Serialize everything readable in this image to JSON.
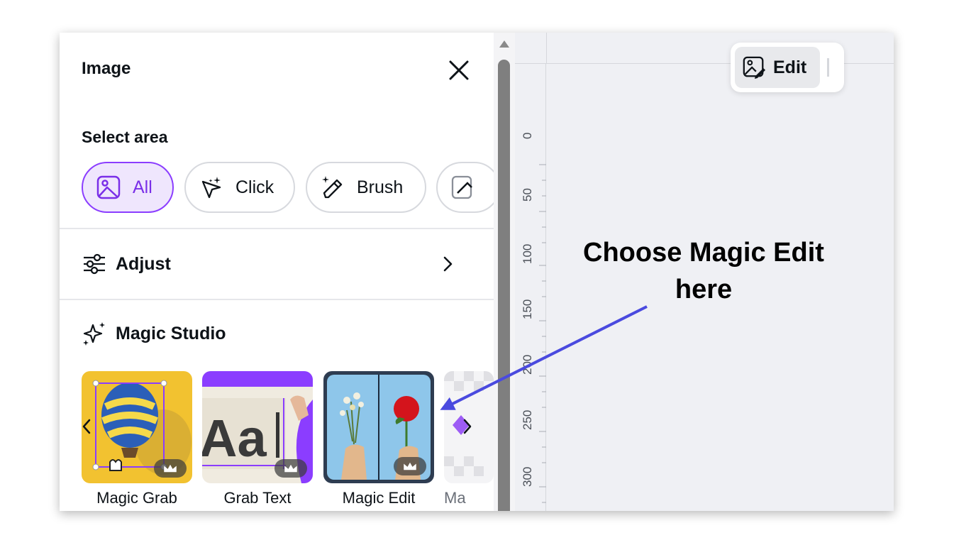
{
  "panel": {
    "title": "Image",
    "select_area": {
      "label": "Select area",
      "options": [
        {
          "label": "All",
          "selected": true
        },
        {
          "label": "Click",
          "selected": false
        },
        {
          "label": "Brush",
          "selected": false
        }
      ]
    },
    "adjust": {
      "label": "Adjust"
    },
    "magic_studio": {
      "label": "Magic Studio",
      "tools": [
        {
          "label": "Magic Grab"
        },
        {
          "label": "Grab Text"
        },
        {
          "label": "Magic Edit"
        },
        {
          "label": "Ma"
        }
      ]
    }
  },
  "canvas": {
    "edit_button": "Edit",
    "ruler_ticks": [
      "0",
      "50",
      "100",
      "150",
      "200",
      "250",
      "300"
    ]
  },
  "annotation": {
    "line1": "Choose Magic Edit",
    "line2": "here"
  },
  "colors": {
    "accent": "#8b3dff",
    "selected_bg": "#efe6fd",
    "arrow": "#4a4adf"
  }
}
